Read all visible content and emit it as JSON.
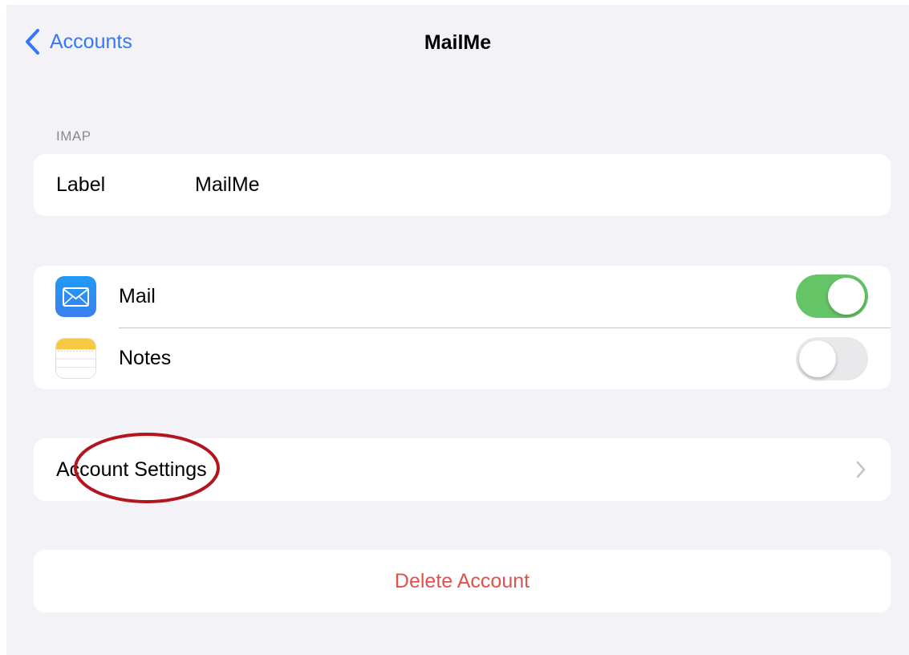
{
  "nav": {
    "back_label": "Accounts",
    "title": "MailMe"
  },
  "section": {
    "header": "IMAP"
  },
  "label_row": {
    "key": "Label",
    "value": "MailMe"
  },
  "apps": [
    {
      "name": "Mail",
      "icon": "mail-icon",
      "enabled": true
    },
    {
      "name": "Notes",
      "icon": "notes-icon",
      "enabled": false
    }
  ],
  "account_settings": {
    "label": "Account Settings"
  },
  "delete": {
    "label": "Delete Account"
  },
  "colors": {
    "accent": "#3478f6",
    "toggle_on": "#65c466",
    "destructive": "#e0524b",
    "annotation": "#b3151e"
  }
}
